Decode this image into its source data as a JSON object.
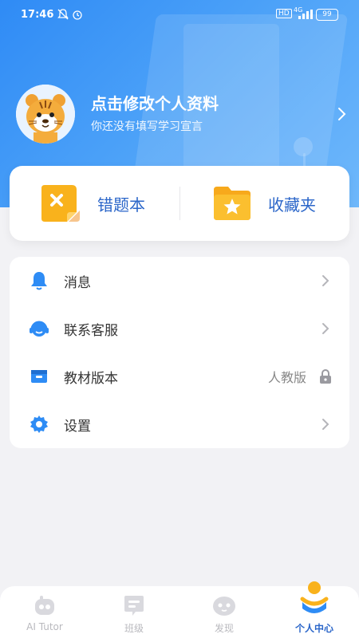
{
  "status_bar": {
    "time": "17:46",
    "network": "4G",
    "battery": "99",
    "hd": "HD"
  },
  "profile": {
    "title": "点击修改个人资料",
    "subtitle": "你还没有填写学习宣言"
  },
  "quick_actions": [
    {
      "label": "错题本",
      "icon": "mistake-book-icon"
    },
    {
      "label": "收藏夹",
      "icon": "favorites-folder-icon"
    }
  ],
  "menu": [
    {
      "label": "消息",
      "value": "",
      "icon": "bell-icon"
    },
    {
      "label": "联系客服",
      "value": "",
      "icon": "headset-icon"
    },
    {
      "label": "教材版本",
      "value": "人教版",
      "icon": "textbook-icon"
    },
    {
      "label": "设置",
      "value": "",
      "icon": "gear-icon"
    }
  ],
  "tabs": [
    {
      "label": "AI Tutor",
      "icon": "robot-icon",
      "active": false
    },
    {
      "label": "班级",
      "icon": "class-icon",
      "active": false
    },
    {
      "label": "发现",
      "icon": "discover-icon",
      "active": false
    },
    {
      "label": "个人中心",
      "icon": "profile-icon",
      "active": true
    }
  ],
  "colors": {
    "accent": "#2b66c9",
    "header_start": "#2f8bf5",
    "header_end": "#6fb8fb",
    "orange": "#f9b21c",
    "icon_blue": "#2e8cf5",
    "inactive": "#b9b9be"
  }
}
